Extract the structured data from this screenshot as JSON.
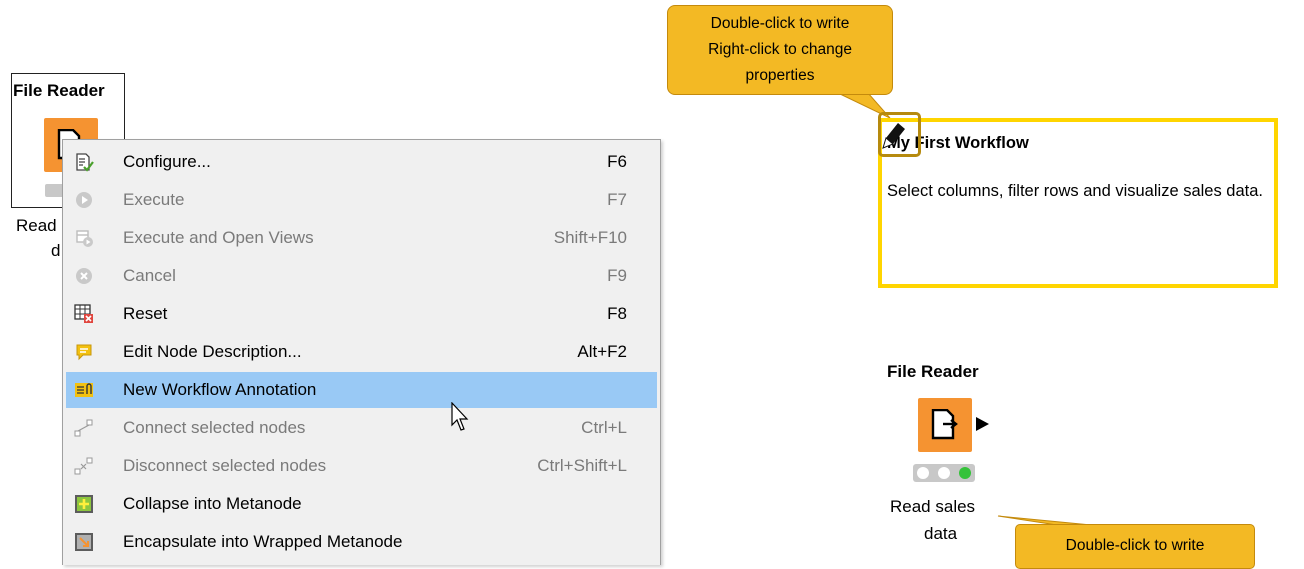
{
  "left_node": {
    "title": "File Reader",
    "label_line1": "Read",
    "label_line2": "d"
  },
  "context_menu": {
    "items": [
      {
        "label": "Configure...",
        "shortcut": "F6",
        "enabled": true,
        "icon": "configure-icon"
      },
      {
        "label": "Execute",
        "shortcut": "F7",
        "enabled": false,
        "icon": "execute-icon"
      },
      {
        "label": "Execute and Open Views",
        "shortcut": "Shift+F10",
        "enabled": false,
        "icon": "execute-open-views-icon"
      },
      {
        "label": "Cancel",
        "shortcut": "F9",
        "enabled": false,
        "icon": "cancel-icon"
      },
      {
        "label": "Reset",
        "shortcut": "F8",
        "enabled": true,
        "icon": "reset-icon"
      },
      {
        "label": "Edit Node Description...",
        "shortcut": "Alt+F2",
        "enabled": true,
        "icon": "comment-icon"
      },
      {
        "label": "New Workflow Annotation",
        "shortcut": "",
        "enabled": true,
        "icon": "annotation-icon",
        "highlighted": true
      },
      {
        "label": "Connect selected nodes",
        "shortcut": "Ctrl+L",
        "enabled": false,
        "icon": "connect-icon"
      },
      {
        "label": "Disconnect selected nodes",
        "shortcut": "Ctrl+Shift+L",
        "enabled": false,
        "icon": "disconnect-icon"
      },
      {
        "label": "Collapse into Metanode",
        "shortcut": "",
        "enabled": true,
        "icon": "collapse-metanode-icon"
      },
      {
        "label": "Encapsulate into Wrapped Metanode",
        "shortcut": "",
        "enabled": true,
        "icon": "wrapped-metanode-icon"
      }
    ]
  },
  "tooltip_top": {
    "line1": "Double-click to write",
    "line2": "Right-click to change",
    "line3": "properties"
  },
  "annotation": {
    "title": "My First Workflow",
    "body": "Select columns, filter rows and visualize sales data."
  },
  "right_node": {
    "title": "File Reader",
    "label_line1": "Read sales",
    "label_line2": "data",
    "status_colors": [
      "#ffffff",
      "#ffffff",
      "#35c23a"
    ]
  },
  "tooltip_bottom": {
    "text": "Double-click to write"
  },
  "colors": {
    "node_orange": "#f59331",
    "menu_highlight": "#99c9f5",
    "annotation_border": "#ffd500",
    "tooltip_fill": "#f3b924"
  }
}
